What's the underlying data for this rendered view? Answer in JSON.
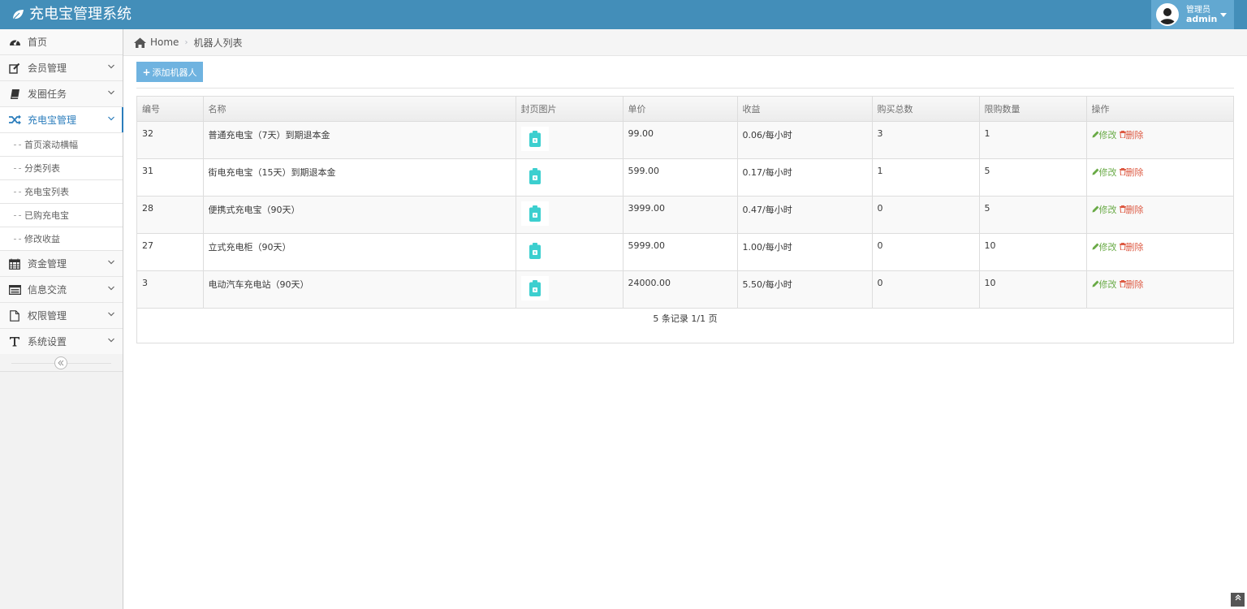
{
  "app": {
    "title": "充电宝管理系统"
  },
  "user": {
    "role": "管理员",
    "name": "admin"
  },
  "colors": {
    "navbar": "#438eb9",
    "accent": "#2b7dbc",
    "edit": "#69aa46",
    "delete": "#dd5a43",
    "add_button": "#6fb3e0"
  },
  "sidebar": {
    "items": [
      {
        "label": "首页",
        "icon": "dashboard-icon"
      },
      {
        "label": "会员管理",
        "icon": "edit-icon"
      },
      {
        "label": "发圈任务",
        "icon": "book-icon"
      },
      {
        "label": "充电宝管理",
        "icon": "shuffle-icon"
      },
      {
        "label": "资金管理",
        "icon": "calendar-icon"
      },
      {
        "label": "信息交流",
        "icon": "list-icon"
      },
      {
        "label": "权限管理",
        "icon": "file-icon"
      },
      {
        "label": "系统设置",
        "icon": "text-icon"
      }
    ],
    "subitems": [
      {
        "label": "首页滚动横幅"
      },
      {
        "label": "分类列表"
      },
      {
        "label": "充电宝列表"
      },
      {
        "label": "已购充电宝"
      },
      {
        "label": "修改收益"
      }
    ]
  },
  "breadcrumb": {
    "home": "Home",
    "current": "机器人列表"
  },
  "toolbar": {
    "add_label": "添加机器人"
  },
  "table": {
    "headers": [
      "编号",
      "名称",
      "封页图片",
      "单价",
      "收益",
      "购买总数",
      "限购数量",
      "操作"
    ],
    "rows": [
      {
        "id": "32",
        "name": "普通充电宝（7天）到期退本金",
        "price": "99.00",
        "income": "0.06/每小时",
        "total": "3",
        "limit": "1"
      },
      {
        "id": "31",
        "name": "街电充电宝（15天）到期退本金",
        "price": "599.00",
        "income": "0.17/每小时",
        "total": "1",
        "limit": "5"
      },
      {
        "id": "28",
        "name": "便携式充电宝（90天）",
        "price": "3999.00",
        "income": "0.47/每小时",
        "total": "0",
        "limit": "5"
      },
      {
        "id": "27",
        "name": "立式充电柜（90天）",
        "price": "5999.00",
        "income": "1.00/每小时",
        "total": "0",
        "limit": "10"
      },
      {
        "id": "3",
        "name": "电动汽车充电站（90天）",
        "price": "24000.00",
        "income": "5.50/每小时",
        "total": "0",
        "limit": "10"
      }
    ],
    "edit_label": "修改",
    "delete_label": "删除"
  },
  "pager": {
    "text": "5 条记录 1/1 页"
  }
}
